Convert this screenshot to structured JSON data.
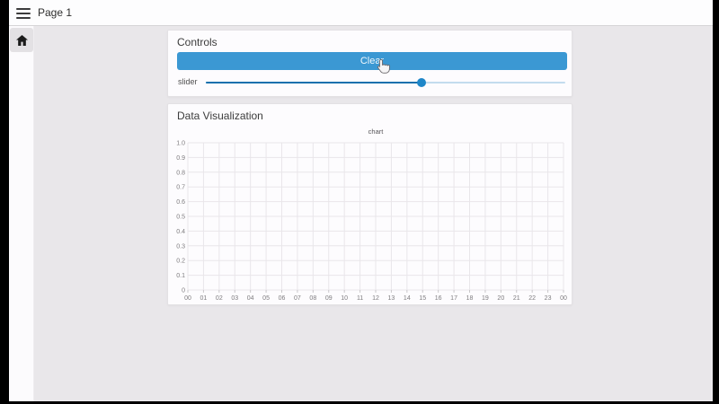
{
  "topbar": {
    "title": "Page 1"
  },
  "sidebar": {
    "items": [
      {
        "icon": "home-icon"
      }
    ]
  },
  "controls_card": {
    "title": "Controls",
    "button": {
      "label": "Clear"
    },
    "slider": {
      "label": "slider",
      "value_percent": 60
    }
  },
  "viz_card": {
    "title": "Data Visualization"
  },
  "chart_data": {
    "type": "line",
    "title": "chart",
    "series": [],
    "x_tick_labels": [
      "00",
      "01",
      "02",
      "03",
      "04",
      "05",
      "06",
      "07",
      "08",
      "09",
      "10",
      "11",
      "12",
      "13",
      "14",
      "15",
      "16",
      "17",
      "18",
      "19",
      "20",
      "21",
      "22",
      "23",
      "00"
    ],
    "y_tick_labels": [
      "1.0",
      "0.9",
      "0.8",
      "0.7",
      "0.6",
      "0.5",
      "0.4",
      "0.3",
      "0.2",
      "0.1",
      "0"
    ],
    "ylim": [
      0,
      1
    ],
    "grid": true,
    "legend": "none"
  },
  "colors": {
    "accent_blue": "#3b98d3",
    "slider_fill": "#1470ad",
    "slider_track": "#c3dcee",
    "slider_thumb": "#1e86c8",
    "grid_line": "#e9e6ea",
    "tick_label": "#7e7c7f",
    "chart_title": "#565458"
  }
}
